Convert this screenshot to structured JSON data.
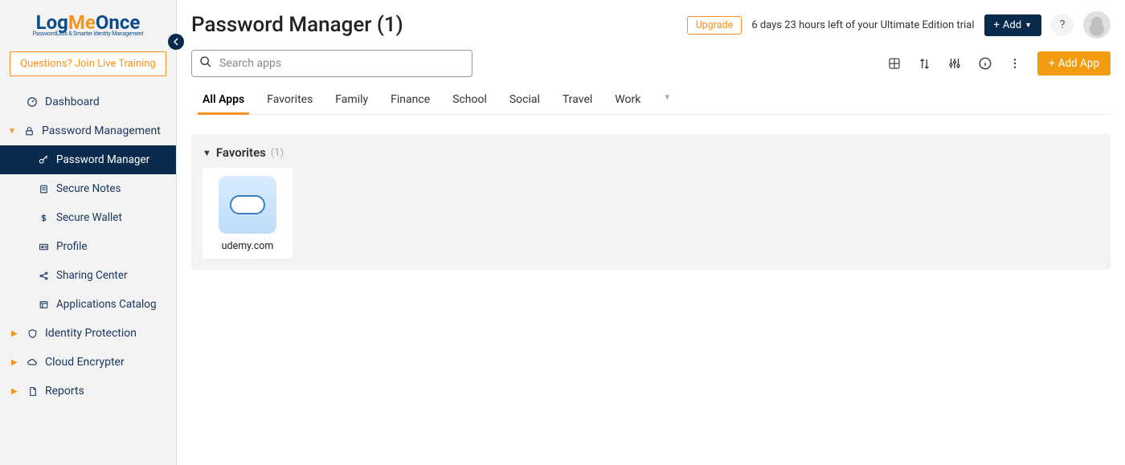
{
  "logo": {
    "part1": "Log",
    "part2": "Me",
    "part3": "Once",
    "caption": "PasswordLess & Smarter Identity Management"
  },
  "sidebar": {
    "live_training": "Questions? Join Live Training",
    "dashboard": "Dashboard",
    "password_mgmt": "Password Management",
    "identity_protection": "Identity Protection",
    "cloud_encrypter": "Cloud Encrypter",
    "reports": "Reports",
    "sub": {
      "password_manager": "Password Manager",
      "secure_notes": "Secure Notes",
      "secure_wallet": "Secure Wallet",
      "profile": "Profile",
      "sharing_center": "Sharing Center",
      "applications_catalog": "Applications Catalog"
    }
  },
  "header": {
    "title": "Password Manager (1)",
    "upgrade": "Upgrade",
    "trial": "6 days 23 hours left of your Ultimate Edition trial",
    "add": "Add",
    "help": "?"
  },
  "search": {
    "placeholder": "Search apps"
  },
  "toolbar": {
    "add_app": "Add App"
  },
  "tabs": [
    "All Apps",
    "Favorites",
    "Family",
    "Finance",
    "School",
    "Social",
    "Travel",
    "Work"
  ],
  "section": {
    "label": "Favorites",
    "count": "(1)"
  },
  "apps": [
    {
      "name": "udemy.com"
    }
  ]
}
